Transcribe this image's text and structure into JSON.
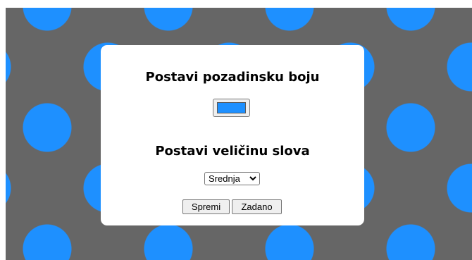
{
  "background": {
    "pattern_color": "#666666",
    "dot_color": "#1e90ff"
  },
  "panel": {
    "background_heading": "Postavi pozadinsku boju",
    "color_picker": {
      "value": "#1e90ff"
    },
    "font_size_heading": "Postavi veličinu slova",
    "font_size_select": {
      "selected": "Srednja"
    },
    "save_label": "Spremi",
    "default_label": "Zadano"
  }
}
